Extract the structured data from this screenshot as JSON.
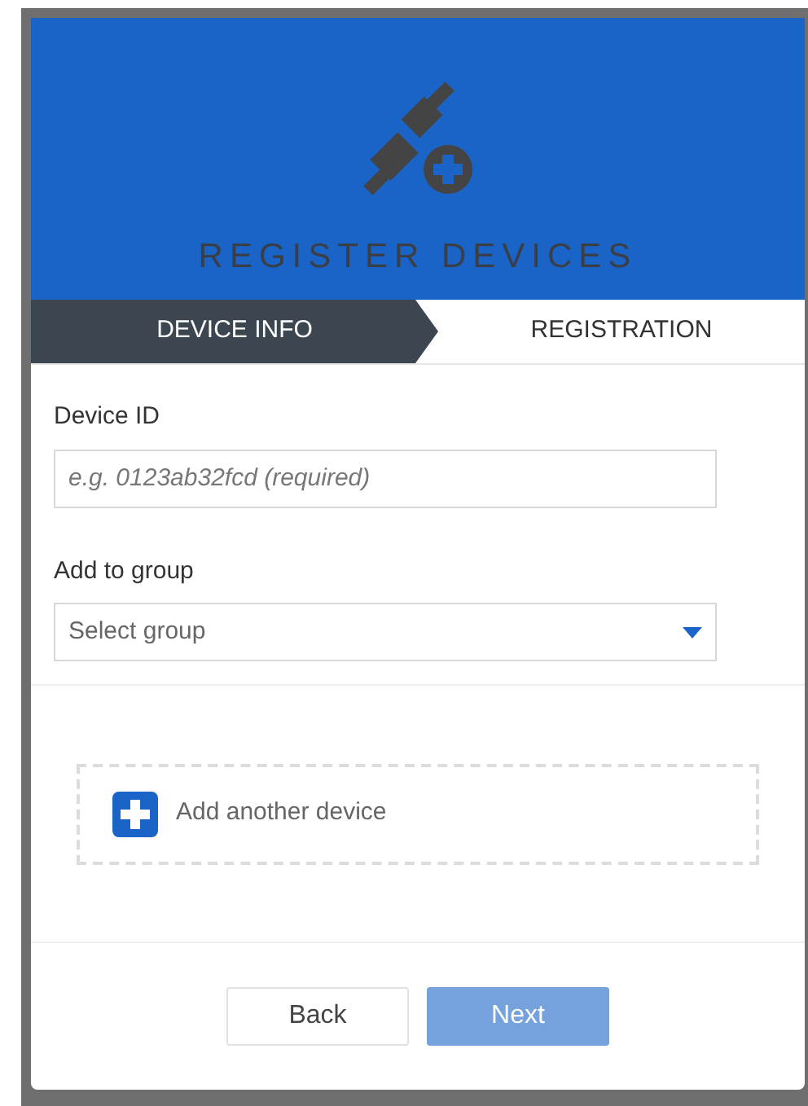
{
  "header": {
    "title": "REGISTER DEVICES"
  },
  "steps": [
    {
      "label": "DEVICE INFO",
      "selected": true
    },
    {
      "label": "REGISTRATION",
      "selected": false
    }
  ],
  "fields": [
    {
      "kind": "text",
      "label": "Device ID",
      "placeholder": "e.g. 0123ab32fcd (required)"
    },
    {
      "kind": "select",
      "label": "Add to group",
      "placeholder": "Select group"
    }
  ],
  "add_device": {
    "label": "Add another device"
  },
  "buttons": [
    {
      "label": "Back",
      "kind": "secondary",
      "disabled": false
    },
    {
      "label": "Next",
      "kind": "primary",
      "disabled": true
    }
  ]
}
